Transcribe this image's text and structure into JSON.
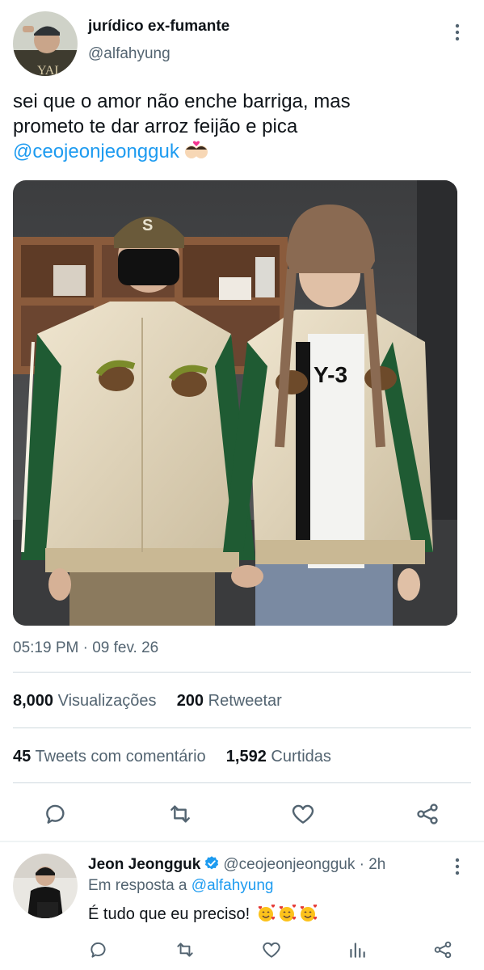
{
  "tweet": {
    "display_name": "jurídico ex-fumante",
    "handle": "@alfahyung",
    "text_line1": "sei que o amor não enche barriga, mas",
    "text_line2": "prometo te dar arroz feijão e pica",
    "text_mention": "@ceojeonjeongguk",
    "timestamp": "05:19 PM · 09 fev. 26",
    "views_count": "8,000",
    "views_label": "Visualizações",
    "retweets_count": "200",
    "retweets_label": "Retweetar",
    "quotes_count": "45",
    "quotes_label": "Tweets com comentário",
    "likes_count": "1,592",
    "likes_label": "Curtidas"
  },
  "actions": [
    "reply-icon",
    "retweet-icon",
    "like-icon",
    "share-icon"
  ],
  "reply": {
    "display_name": "Jeon Jeongguk",
    "handle": "@ceojeonjeongguk",
    "separator": "·",
    "time": "2h",
    "replying_prefix": "Em resposta a",
    "replying_to": "@alfahyung",
    "text": "É tudo que eu preciso!",
    "actions": [
      "reply-icon",
      "retweet-icon",
      "like-icon",
      "views-icon",
      "share-icon"
    ]
  },
  "colors": {
    "accent": "#1d9bf0",
    "secondary_text": "#536471",
    "divider": "#cfd9de"
  }
}
